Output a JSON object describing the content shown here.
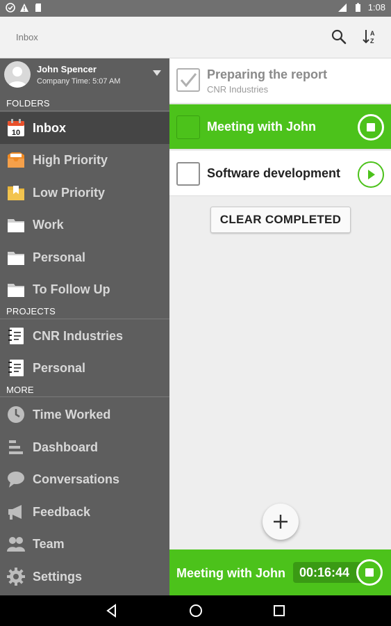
{
  "status_bar": {
    "time": "1:08"
  },
  "app_bar": {
    "title": "Inbox"
  },
  "account": {
    "name": "John Spencer",
    "subtitle": "Company Time: 5:07 AM"
  },
  "sections": {
    "folders": "FOLDERS",
    "projects": "PROJECTS",
    "more": "MORE"
  },
  "folders": [
    {
      "label": "Inbox",
      "icon": "calendar-icon",
      "badge": "10",
      "active": true
    },
    {
      "label": "High Priority",
      "icon": "inbox-tray-orange-icon"
    },
    {
      "label": "Low Priority",
      "icon": "bookmark-folder-yellow-icon"
    },
    {
      "label": "Work",
      "icon": "folder-icon"
    },
    {
      "label": "Personal",
      "icon": "folder-icon"
    },
    {
      "label": "To Follow Up",
      "icon": "folder-icon"
    }
  ],
  "projects": [
    {
      "label": "CNR Industries",
      "icon": "notebook-icon"
    },
    {
      "label": "Personal",
      "icon": "notebook-icon"
    }
  ],
  "more": [
    {
      "label": "Time Worked",
      "icon": "clock-icon"
    },
    {
      "label": "Dashboard",
      "icon": "bar-list-icon"
    },
    {
      "label": "Conversations",
      "icon": "chat-bubble-icon"
    },
    {
      "label": "Feedback",
      "icon": "megaphone-icon"
    },
    {
      "label": "Team",
      "icon": "people-icon"
    },
    {
      "label": "Settings",
      "icon": "gear-icon"
    }
  ],
  "tasks": [
    {
      "title": "Preparing the report",
      "project": "CNR Industries",
      "state": "completed"
    },
    {
      "title": "Meeting with John",
      "state": "running"
    },
    {
      "title": "Software development",
      "state": "stopped"
    }
  ],
  "clear_completed_label": "CLEAR COMPLETED",
  "timer_bar": {
    "task": "Meeting with John",
    "elapsed": "00:16:44"
  },
  "colors": {
    "accent": "#4cc21b",
    "drawer": "#5e5e5e",
    "drawer_active": "#454545",
    "status_bar": "#707070"
  }
}
